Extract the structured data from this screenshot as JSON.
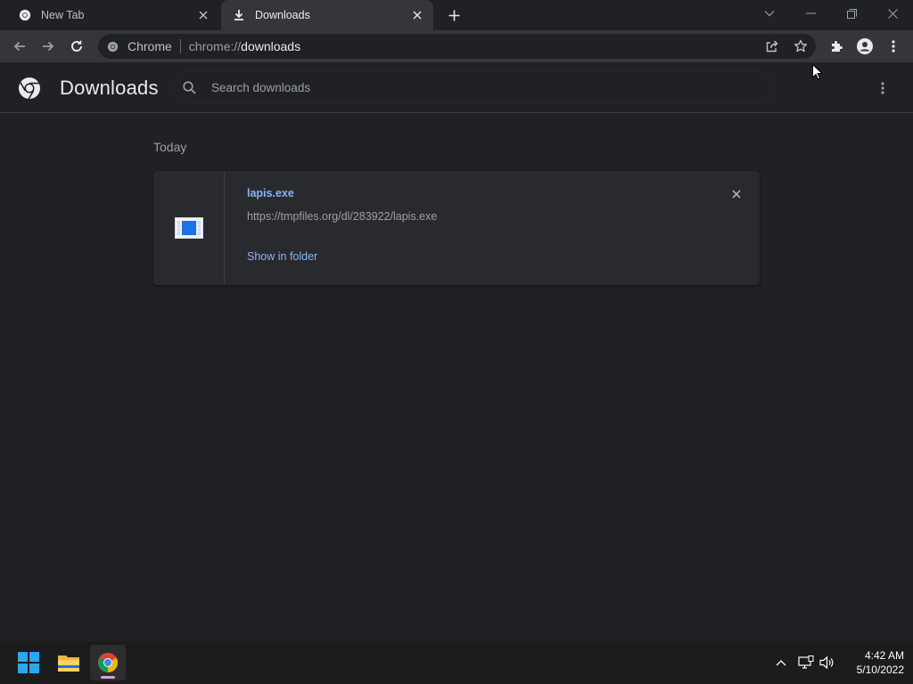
{
  "tabs": [
    {
      "title": "New Tab",
      "icon": "chrome-icon",
      "active": false
    },
    {
      "title": "Downloads",
      "icon": "download-icon",
      "active": true
    }
  ],
  "omnibox": {
    "chip_label": "Chrome",
    "url_scheme": "chrome://",
    "url_host": "downloads"
  },
  "downloads": {
    "page_title": "Downloads",
    "search_placeholder": "Search downloads",
    "section_date": "Today",
    "items": [
      {
        "file_name": "lapis.exe",
        "url": "https://tmpfiles.org/dl/283922/lapis.exe",
        "action_label": "Show in folder"
      }
    ]
  },
  "taskbar": {
    "time": "4:42 AM",
    "date": "5/10/2022"
  },
  "colors": {
    "accent_link": "#8ab4f8",
    "background": "#202124",
    "toolbar": "#35363a",
    "card": "#292a2d"
  }
}
